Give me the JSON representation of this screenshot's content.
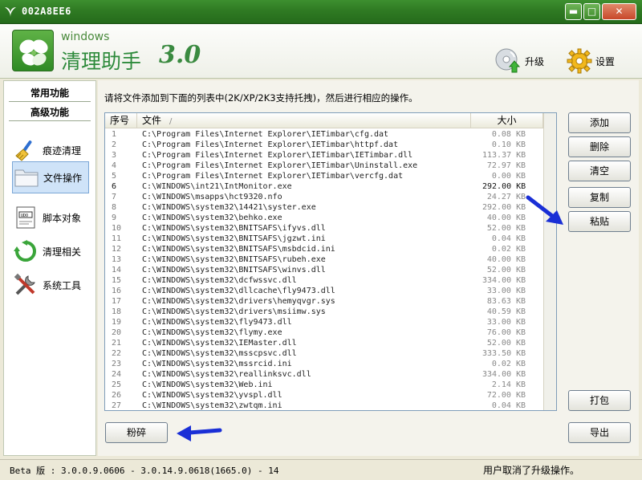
{
  "window": {
    "title": "002A8EE6",
    "minimize_label": "▬",
    "maximize_label": "□",
    "close_label": "✕"
  },
  "brand": {
    "small": "windows",
    "main": "清理助手",
    "version": "3.0"
  },
  "header": {
    "upgrade_label": "升级",
    "settings_label": "设置"
  },
  "nav": {
    "common_label": "常用功能",
    "advanced_label": "高级功能",
    "items": [
      {
        "label": "痕迹清理",
        "icon": "broom-icon",
        "active": false
      },
      {
        "label": "文件操作",
        "icon": "folder-icon",
        "active": true
      },
      {
        "label": "脚本对象",
        "icon": "script-icon",
        "active": false
      },
      {
        "label": "清理相关",
        "icon": "refresh-icon",
        "active": false
      },
      {
        "label": "系统工具",
        "icon": "tools-icon",
        "active": false
      }
    ]
  },
  "main": {
    "instruction": "请将文件添加到下面的列表中(2K/XP/2K3支持托拽)，然后进行相应的操作。",
    "columns": {
      "index": "序号",
      "file": "文件",
      "size": "大小",
      "sort_mark": "/"
    },
    "rows": [
      {
        "index": "1",
        "file": "C:\\Program Files\\Internet Explorer\\IETimbar\\cfg.dat",
        "size": "0.08 KB"
      },
      {
        "index": "2",
        "file": "C:\\Program Files\\Internet Explorer\\IETimbar\\httpf.dat",
        "size": "0.10 KB"
      },
      {
        "index": "3",
        "file": "C:\\Program Files\\Internet Explorer\\IETimbar\\IETimbar.dll",
        "size": "113.37 KB"
      },
      {
        "index": "4",
        "file": "C:\\Program Files\\Internet Explorer\\IETimbar\\Uninstall.exe",
        "size": "72.97 KB"
      },
      {
        "index": "5",
        "file": "C:\\Program Files\\Internet Explorer\\IETimbar\\vercfg.dat",
        "size": "0.00 KB"
      },
      {
        "index": "6",
        "file": "C:\\WINDOWS\\int21\\IntMonitor.exe",
        "size": "292.00 KB",
        "dark": true
      },
      {
        "index": "7",
        "file": "C:\\WINDOWS\\msapps\\hct9320.nfo",
        "size": "24.27 KB"
      },
      {
        "index": "8",
        "file": "C:\\WINDOWS\\system32\\14421\\syster.exe",
        "size": "292.00 KB"
      },
      {
        "index": "9",
        "file": "C:\\WINDOWS\\system32\\behko.exe",
        "size": "40.00 KB"
      },
      {
        "index": "10",
        "file": "C:\\WINDOWS\\system32\\BNITSAFS\\ifyvs.dll",
        "size": "52.00 KB"
      },
      {
        "index": "11",
        "file": "C:\\WINDOWS\\system32\\BNITSAFS\\jgzwt.ini",
        "size": "0.04 KB"
      },
      {
        "index": "12",
        "file": "C:\\WINDOWS\\system32\\BNITSAFS\\msbdcid.ini",
        "size": "0.02 KB"
      },
      {
        "index": "13",
        "file": "C:\\WINDOWS\\system32\\BNITSAFS\\rubeh.exe",
        "size": "40.00 KB"
      },
      {
        "index": "14",
        "file": "C:\\WINDOWS\\system32\\BNITSAFS\\winvs.dll",
        "size": "52.00 KB"
      },
      {
        "index": "15",
        "file": "C:\\WINDOWS\\system32\\dcfwssvc.dll",
        "size": "334.00 KB"
      },
      {
        "index": "16",
        "file": "C:\\WINDOWS\\system32\\dllcache\\fly9473.dll",
        "size": "33.00 KB"
      },
      {
        "index": "17",
        "file": "C:\\WINDOWS\\system32\\drivers\\hemyqvgr.sys",
        "size": "83.63 KB"
      },
      {
        "index": "18",
        "file": "C:\\WINDOWS\\system32\\drivers\\msiimw.sys",
        "size": "40.59 KB"
      },
      {
        "index": "19",
        "file": "C:\\WINDOWS\\system32\\fly9473.dll",
        "size": "33.00 KB"
      },
      {
        "index": "20",
        "file": "C:\\WINDOWS\\system32\\flymy.exe",
        "size": "76.00 KB"
      },
      {
        "index": "21",
        "file": "C:\\WINDOWS\\system32\\IEMaster.dll",
        "size": "52.00 KB"
      },
      {
        "index": "22",
        "file": "C:\\WINDOWS\\system32\\msscpsvc.dll",
        "size": "333.50 KB"
      },
      {
        "index": "23",
        "file": "C:\\WINDOWS\\system32\\mssrcid.ini",
        "size": "0.02 KB"
      },
      {
        "index": "24",
        "file": "C:\\WINDOWS\\system32\\reallinksvc.dll",
        "size": "334.00 KB"
      },
      {
        "index": "25",
        "file": "C:\\WINDOWS\\system32\\Web.ini",
        "size": "2.14 KB"
      },
      {
        "index": "26",
        "file": "C:\\WINDOWS\\system32\\yvspl.dll",
        "size": "72.00 KB"
      },
      {
        "index": "27",
        "file": "C:\\WINDOWS\\system32\\zwtqm.ini",
        "size": "0.04 KB"
      }
    ],
    "buttons": {
      "add": "添加",
      "delete": "删除",
      "clear": "清空",
      "copy": "复制",
      "paste": "粘贴",
      "pack": "打包",
      "export": "导出",
      "shred": "粉碎"
    }
  },
  "status": {
    "left": "Beta 版 : 3.0.0.9.0606 - 3.0.14.9.0618(1665.0) - 14",
    "right": "用户取消了升级操作。"
  },
  "colors": {
    "titlebar": "#2f7a23",
    "brand_green": "#2d8a3b",
    "arrow_blue": "#1a2fd6",
    "selected_nav": "#cfe3f8"
  }
}
